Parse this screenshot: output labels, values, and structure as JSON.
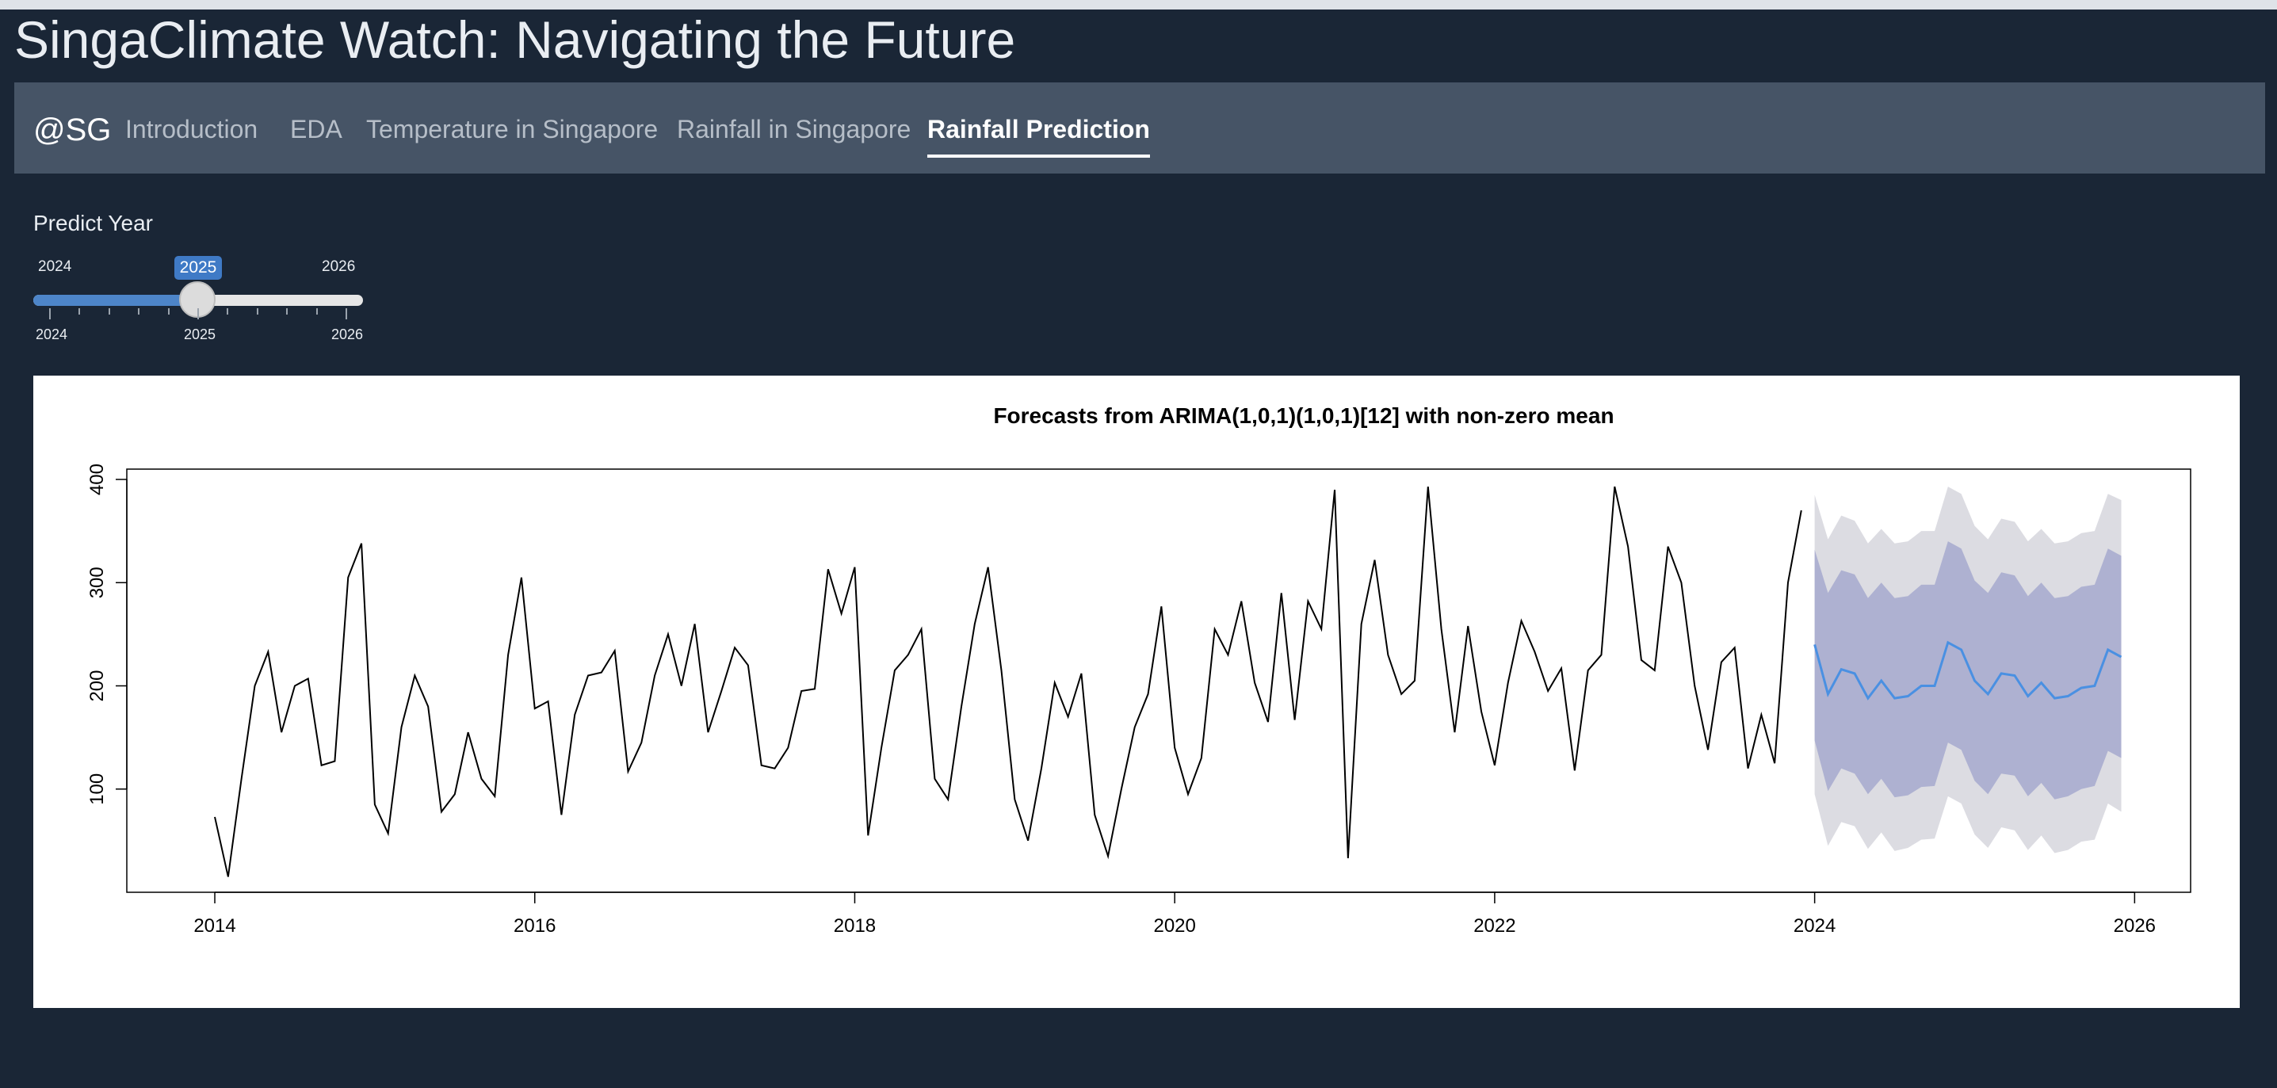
{
  "app": {
    "title": "SingaClimate Watch: Navigating the Future"
  },
  "navbar": {
    "brand": "@SG",
    "tabs": [
      {
        "label": "Introduction"
      },
      {
        "label": "EDA"
      },
      {
        "label": "Temperature in Singapore"
      },
      {
        "label": "Rainfall in Singapore"
      },
      {
        "label": "Rainfall Prediction"
      }
    ],
    "active_tab": "Rainfall Prediction"
  },
  "slider": {
    "label": "Predict Year",
    "min": "2024",
    "max": "2026",
    "value": "2025",
    "grid": [
      "2024",
      "2025",
      "2026"
    ]
  },
  "chart_data": {
    "type": "line",
    "title": "Forecasts from ARIMA(1,0,1)(1,0,1)[12] with non-zero mean",
    "xlabel": "",
    "ylabel": "",
    "xlim": [
      2013.45,
      2026.35
    ],
    "ylim": [
      0,
      410
    ],
    "x_ticks": [
      "2014",
      "2016",
      "2018",
      "2020",
      "2022",
      "2024",
      "2026"
    ],
    "y_ticks": [
      "100",
      "200",
      "300",
      "400"
    ],
    "grid": false,
    "observed": {
      "start": 2014.0,
      "frequency": 12,
      "values": [
        73,
        15,
        110,
        200,
        233,
        155,
        200,
        207,
        123,
        127,
        305,
        338,
        85,
        57,
        160,
        210,
        180,
        78,
        95,
        155,
        110,
        93,
        230,
        305,
        178,
        185,
        75,
        172,
        210,
        213,
        234,
        117,
        145,
        210,
        250,
        200,
        260,
        155,
        195,
        237,
        220,
        123,
        120,
        140,
        195,
        197,
        313,
        270,
        315,
        55,
        140,
        215,
        230,
        255,
        110,
        90,
        180,
        260,
        315,
        215,
        90,
        50,
        120,
        203,
        170,
        212,
        75,
        35,
        100,
        160,
        192,
        277,
        140,
        95,
        130,
        255,
        230,
        282,
        203,
        165,
        290,
        167,
        282,
        255,
        390,
        33,
        260,
        322,
        230,
        192,
        205,
        393,
        255,
        155,
        258,
        175,
        123,
        203,
        263,
        233,
        195,
        217,
        118,
        215,
        230,
        393,
        335,
        225,
        215,
        335,
        300,
        200,
        138,
        223,
        237,
        120,
        172,
        125,
        300,
        370
      ]
    },
    "forecast": {
      "start": 2024.0,
      "frequency": 12,
      "mean": [
        240,
        192,
        216,
        212,
        188,
        205,
        188,
        190,
        200,
        200,
        242,
        235,
        205,
        192,
        212,
        210,
        190,
        203,
        188,
        190,
        198,
        200,
        235,
        228
      ],
      "lo80": [
        147,
        98,
        120,
        115,
        95,
        110,
        92,
        94,
        102,
        103,
        145,
        138,
        108,
        95,
        115,
        113,
        93,
        106,
        90,
        93,
        100,
        103,
        137,
        130
      ],
      "hi80": [
        332,
        290,
        312,
        308,
        285,
        300,
        285,
        287,
        298,
        298,
        340,
        333,
        302,
        290,
        310,
        307,
        287,
        300,
        285,
        287,
        296,
        298,
        333,
        326
      ],
      "lo95": [
        95,
        45,
        68,
        64,
        42,
        58,
        40,
        43,
        51,
        52,
        93,
        86,
        56,
        43,
        63,
        60,
        41,
        55,
        38,
        41,
        49,
        51,
        86,
        78
      ],
      "hi95": [
        385,
        342,
        365,
        360,
        338,
        352,
        338,
        340,
        350,
        350,
        393,
        386,
        355,
        342,
        362,
        359,
        340,
        352,
        338,
        340,
        348,
        350,
        386,
        380
      ]
    },
    "colors": {
      "observed": "#000000",
      "mean": "#4a90e2",
      "band80": "#aeb1d1",
      "band95": "#dcdce2"
    }
  }
}
